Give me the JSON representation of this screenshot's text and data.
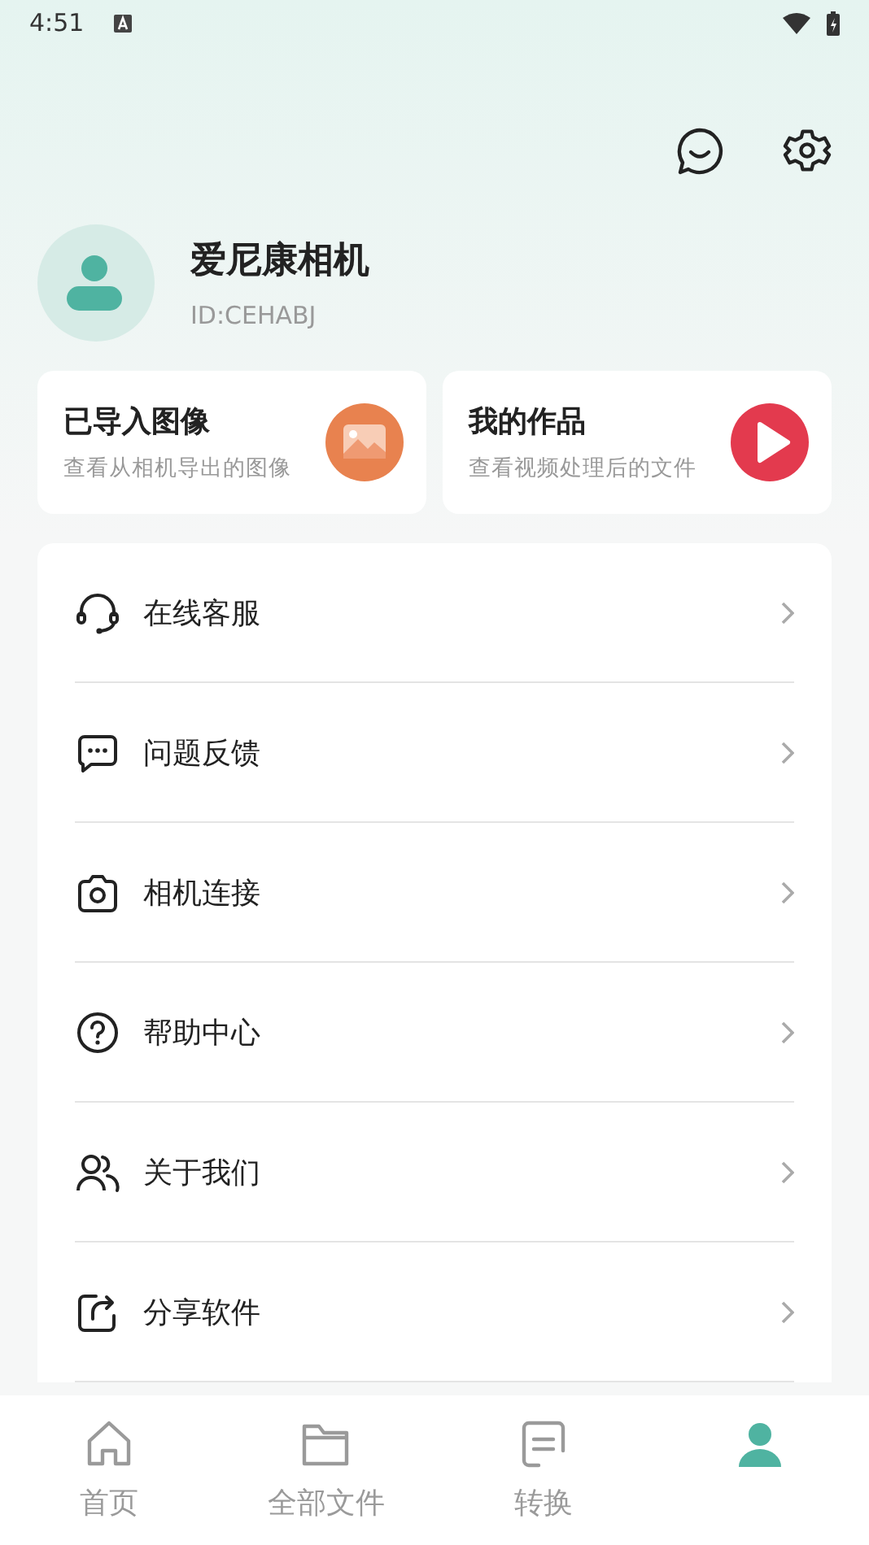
{
  "status_bar": {
    "time": "4:51"
  },
  "profile": {
    "name": "爱尼康相机",
    "id": "ID:CEHABJ"
  },
  "cards": [
    {
      "title": "已导入图像",
      "subtitle": "查看从相机导出的图像",
      "kind": "image"
    },
    {
      "title": "我的作品",
      "subtitle": "查看视频处理后的文件",
      "kind": "play"
    }
  ],
  "menu": [
    {
      "label": "在线客服",
      "kind": "headset"
    },
    {
      "label": "问题反馈",
      "kind": "chat"
    },
    {
      "label": "相机连接",
      "kind": "camera"
    },
    {
      "label": "帮助中心",
      "kind": "help"
    },
    {
      "label": "关于我们",
      "kind": "people"
    },
    {
      "label": "分享软件",
      "kind": "share"
    }
  ],
  "tabs": [
    {
      "label": "首页",
      "kind": "home",
      "selected": false
    },
    {
      "label": "全部文件",
      "kind": "folder",
      "selected": false
    },
    {
      "label": "转换",
      "kind": "doc",
      "selected": false
    },
    {
      "kind": "person",
      "selected": true
    }
  ]
}
